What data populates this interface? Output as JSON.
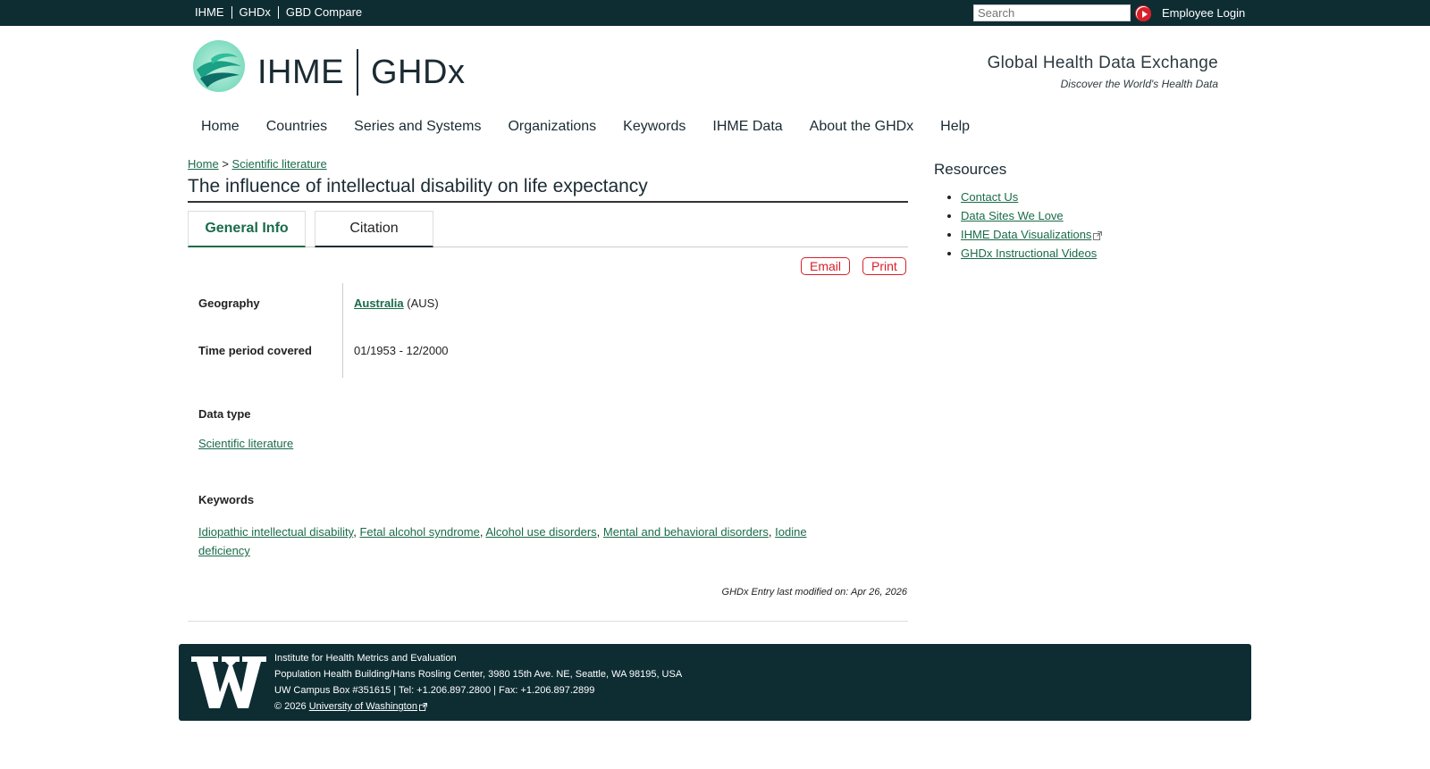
{
  "topbar": {
    "links": [
      "IHME",
      "GHDx",
      "GBD Compare"
    ],
    "search_placeholder": "Search",
    "employee_login": "Employee Login"
  },
  "header": {
    "brand_left": "IHME",
    "brand_right": "GHDx",
    "tagline_title": "Global Health Data Exchange",
    "tagline_sub": "Discover the World's Health Data"
  },
  "nav": {
    "items": [
      "Home",
      "Countries",
      "Series and Systems",
      "Organizations",
      "Keywords",
      "IHME Data",
      "About the GHDx",
      "Help"
    ]
  },
  "breadcrumb": {
    "home": "Home",
    "separator": ">",
    "current": "Scientific literature"
  },
  "page": {
    "title": "The influence of intellectual disability on life expectancy",
    "tabs": [
      "General Info",
      "Citation"
    ],
    "actions": [
      "Email",
      "Print"
    ]
  },
  "info": {
    "geography_label": "Geography",
    "geography_value": "Australia",
    "geography_code": "(AUS)",
    "time_label": "Time period covered",
    "time_value": "01/1953 - 12/2000"
  },
  "data_type": {
    "label": "Data type",
    "value": "Scientific literature"
  },
  "keywords": {
    "label": "Keywords",
    "items": [
      "Idiopathic intellectual disability",
      "Fetal alcohol syndrome",
      "Alcohol use disorders",
      "Mental and behavioral disorders",
      "Iodine deficiency"
    ],
    "separator": ", "
  },
  "modified": "GHDx Entry last modified on: Apr 26, 2026",
  "sidebar": {
    "title": "Resources",
    "items": [
      "Contact Us",
      "Data Sites We Love",
      "IHME Data Visualizations",
      "GHDx Instructional Videos"
    ]
  },
  "footer": {
    "line1": "Institute for Health Metrics and Evaluation",
    "line2": "Population Health Building/Hans Rosling Center, 3980 15th Ave. NE, Seattle, WA 98195, USA",
    "line3": "UW Campus Box #351615 | Tel: +1.206.897.2800 | Fax: +1.206.897.2899",
    "copyright": "© 2026",
    "uw_link": "University of Washington"
  },
  "colors": {
    "topbar_bg": "#0e2d33",
    "link_green": "#1a6b4a",
    "action_red": "#d7202a"
  }
}
